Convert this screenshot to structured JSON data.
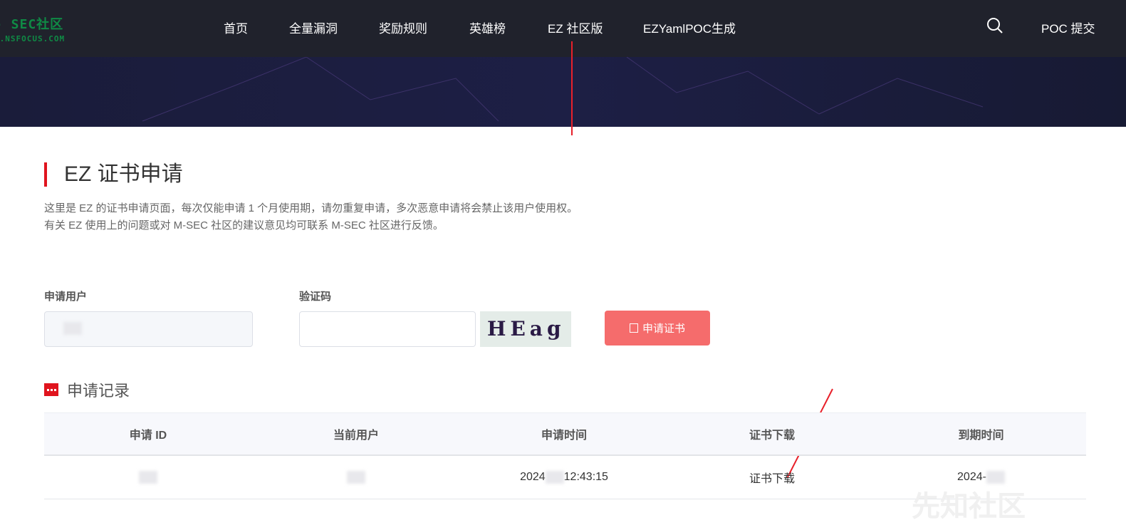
{
  "header": {
    "logo_line1": "- SEC社区",
    "logo_line2": "C.NSFOCUS.COM",
    "nav": [
      "首页",
      "全量漏洞",
      "奖励规则",
      "英雄榜",
      "EZ 社区版",
      "EZYamlPOC生成"
    ],
    "submit_poc": "POC 提交"
  },
  "page": {
    "title": "EZ 证书申请",
    "desc1": "这里是 EZ 的证书申请页面，每次仅能申请 1 个月使用期，请勿重复申请，多次恶意申请将会禁止该用户使用权。",
    "desc2": "有关 EZ 使用上的问题或对 M-SEC 社区的建议意见均可联系 M-SEC 社区进行反馈。"
  },
  "form": {
    "user_label": "申请用户",
    "captcha_label": "验证码",
    "captcha_text": "HEag",
    "apply_button": "申请证书"
  },
  "records": {
    "title": "申请记录",
    "columns": [
      "申请 ID",
      "当前用户",
      "申请时间",
      "证书下载",
      "到期时间"
    ],
    "rows": [
      {
        "id": "",
        "user": "",
        "time_prefix": "2024",
        "time_suffix": "12:43:15",
        "download": "证书下载",
        "expire": "2024-"
      }
    ]
  },
  "watermark": "先知社区"
}
